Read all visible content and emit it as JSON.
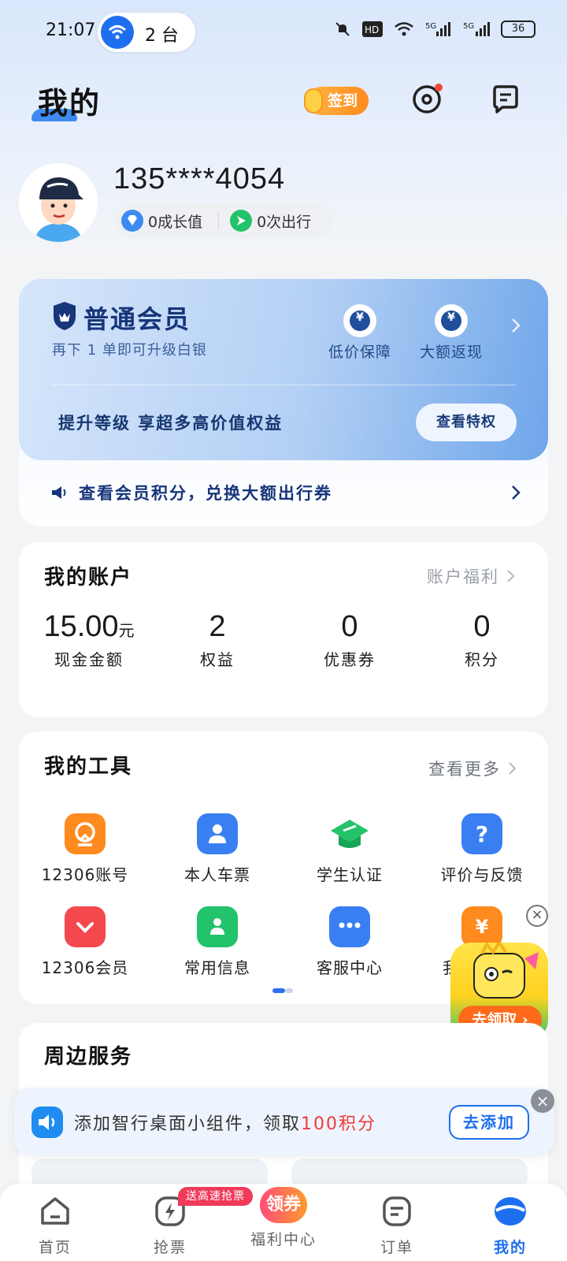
{
  "status_bar": {
    "time": "21:07",
    "device_count": "2 台",
    "battery": "36",
    "icons": [
      "mute-icon",
      "hd-icon",
      "wifi-icon",
      "signal-5g-icon",
      "signal-5g-icon"
    ]
  },
  "header": {
    "title": "我的",
    "checkin_label": "签到",
    "icons": [
      "settings-icon",
      "message-icon"
    ]
  },
  "profile": {
    "phone": "135****4054",
    "growth_label": "0成长值",
    "trips_label": "0次出行"
  },
  "membership": {
    "level": "普通会员",
    "subtitle": "再下 1 单即可升级白银",
    "perks": [
      {
        "label": "低价保障",
        "icon": "yen-shield-icon"
      },
      {
        "label": "大额返现",
        "icon": "yen-coin-icon"
      }
    ],
    "promo_text": "提升等级 享超多高价值权益",
    "view_perks_button": "查看特权",
    "points_link": "查看会员积分，兑换大额出行券"
  },
  "account": {
    "title": "我的账户",
    "link": "账户福利",
    "items": [
      {
        "value": "15.00",
        "unit": "元",
        "label": "现金金额"
      },
      {
        "value": "2",
        "label": "权益"
      },
      {
        "value": "0",
        "label": "优惠券"
      },
      {
        "value": "0",
        "label": "积分"
      }
    ]
  },
  "tools": {
    "title": "我的工具",
    "link": "查看更多",
    "items": [
      {
        "label": "12306账号",
        "icon": "railway-logo-icon",
        "color": "#ff8a1e"
      },
      {
        "label": "本人车票",
        "icon": "person-ticket-icon",
        "color": "#3a7ff2"
      },
      {
        "label": "学生认证",
        "icon": "graduation-cap-icon",
        "color": "#22c36a"
      },
      {
        "label": "评价与反馈",
        "icon": "question-icon",
        "color": "#3a7ff2"
      },
      {
        "label": "12306会员",
        "icon": "member-heart-icon",
        "color": "#f2484e"
      },
      {
        "label": "常用信息",
        "icon": "contact-card-icon",
        "color": "#22c36a"
      },
      {
        "label": "客服中心",
        "icon": "chat-bubble-icon",
        "color": "#3a7ff2"
      },
      {
        "label": "我",
        "icon": "yen-bag-icon",
        "color": "#ff8a1e"
      }
    ]
  },
  "nearby": {
    "title": "周边服务"
  },
  "floating_promo": {
    "button": "去领取"
  },
  "widget_banner": {
    "text": "添加智行桌面小组件，领取",
    "highlight": "100积分",
    "button": "去添加"
  },
  "tabbar": {
    "badge": "送高速抢票",
    "center_badge": "领券",
    "tabs": [
      {
        "label": "首页",
        "icon": "home-icon"
      },
      {
        "label": "抢票",
        "icon": "lightning-icon"
      },
      {
        "label": "福利中心",
        "icon": "coupon-icon"
      },
      {
        "label": "订单",
        "icon": "order-icon"
      },
      {
        "label": "我的",
        "icon": "profile-icon"
      }
    ]
  },
  "colors": {
    "primary": "#1e6ff0",
    "member_dark": "#16357a",
    "accent_red": "#f03a3a",
    "checkin_orange": "#ff8a1e"
  }
}
